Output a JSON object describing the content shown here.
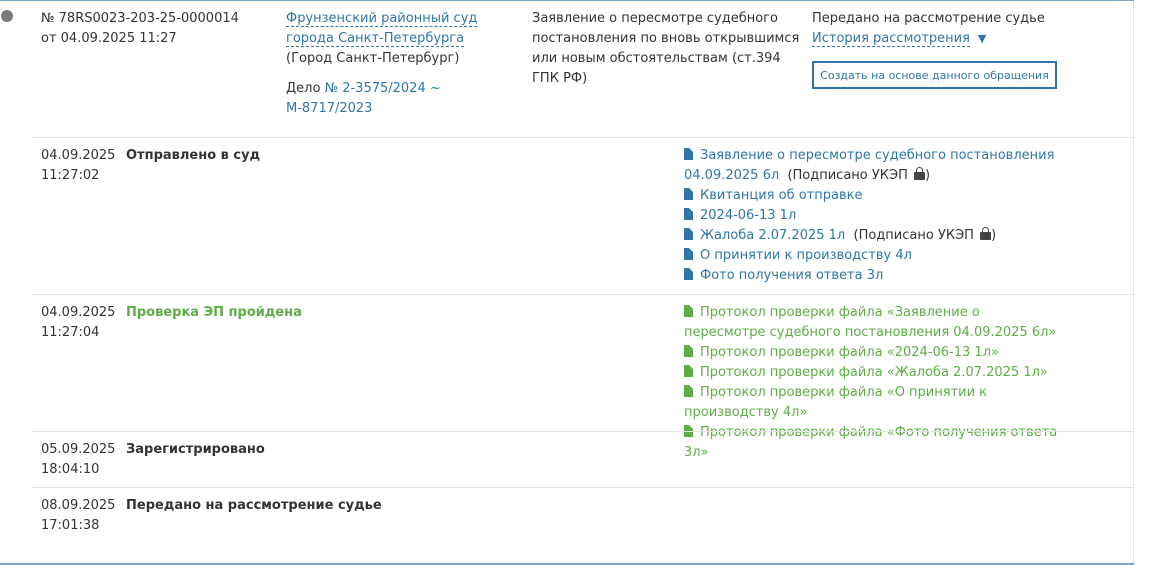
{
  "appeal": {
    "number": "№ 78RS0023-203-25-0000014",
    "date": "от 04.09.2025 11:27",
    "court_link": "Фрунзенский районный суд города Санкт-Петербурга",
    "court_city": "(Город Санкт-Петербург)",
    "case_prefix": "Дело",
    "case_link": "№ 2-3575/2024 ~ М-8717/2023",
    "description": "Заявление о пересмотре судебного постановления по вновь открывшимся или новым обстоятельствам (ст.394 ГПК РФ)",
    "status": "Передано на рассмотрение судье",
    "history_link": "История рассмотрения",
    "history_caret": "▼",
    "create_button": "Создать на основе данного обращения"
  },
  "events": [
    {
      "date": "04.09.2025",
      "time": "11:27:02",
      "title": "Отправлено в суд",
      "docs": [
        {
          "text": "Заявление о пересмотре судебного постановления 04.09.2025 6л",
          "signed": "(Подписано УКЭП",
          "signed_end": ")"
        },
        {
          "text": "Квитанция об отправке"
        },
        {
          "text": "2024-06-13 1л"
        },
        {
          "text": "Жалоба 2.07.2025 1л",
          "signed": "(Подписано УКЭП",
          "signed_end": ")"
        },
        {
          "text": "О принятии к производству 4л"
        },
        {
          "text": "Фото получения ответа 3л"
        }
      ]
    },
    {
      "date": "04.09.2025",
      "time": "11:27:04",
      "title": "Проверка ЭП пройдена",
      "docs": [
        {
          "text": "Протокол проверки файла «Заявление о пересмотре судебного постановления 04.09.2025 6л»"
        },
        {
          "text": "Протокол проверки файла «2024-06-13 1л»"
        },
        {
          "text": "Протокол проверки файла «Жалоба 2.07.2025 1л»"
        },
        {
          "text": "Протокол проверки файла «О принятии к производству 4л»"
        },
        {
          "text": "Протокол проверки файла «Фото получения ответа 3л»"
        }
      ]
    },
    {
      "date": "05.09.2025",
      "time": "18:04:10",
      "title": "Зарегистрировано"
    },
    {
      "date": "08.09.2025",
      "time": "17:01:38",
      "title": "Передано на рассмотрение судье"
    }
  ],
  "colors": {
    "link": "#2f76a6",
    "success": "#5cad45",
    "border": "#7aa7c7"
  }
}
